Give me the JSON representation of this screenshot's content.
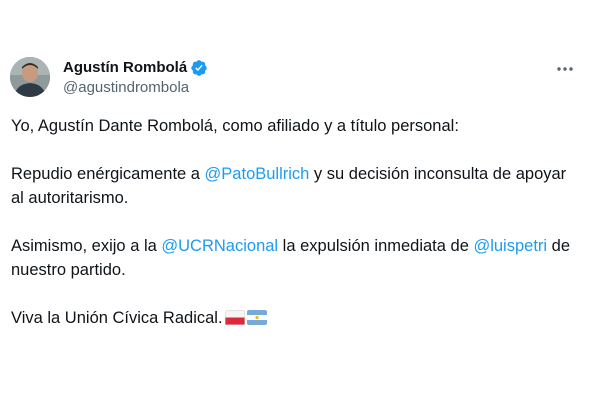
{
  "author": {
    "display_name": "Agustín Rombolá",
    "handle": "@agustindrombola",
    "verified": true
  },
  "tweet": {
    "p1": "Yo, Agustín Dante Rombolá, como afiliado y a título personal:",
    "p2_a": "Repudio enérgicamente a ",
    "p2_mention": "@PatoBullrich",
    "p2_b": " y su decisión inconsulta de apoyar al autoritarismo.",
    "p3_a": "Asimismo, exijo a la ",
    "p3_mention1": "@UCRNacional",
    "p3_b": " la expulsión inmediata de ",
    "p3_mention2": "@luispetri",
    "p3_c": " de nuestro partido.",
    "p4": "Viva la Unión Cívica Radical."
  },
  "icons": {
    "verified": "verified-badge-icon",
    "more": "more-options-icon",
    "flag1": "red-white-flag-icon",
    "flag2": "argentina-flag-icon"
  },
  "colors": {
    "text": "#0f1419",
    "secondary": "#536471",
    "link": "#1d9bf0",
    "verified": "#1d9bf0"
  }
}
